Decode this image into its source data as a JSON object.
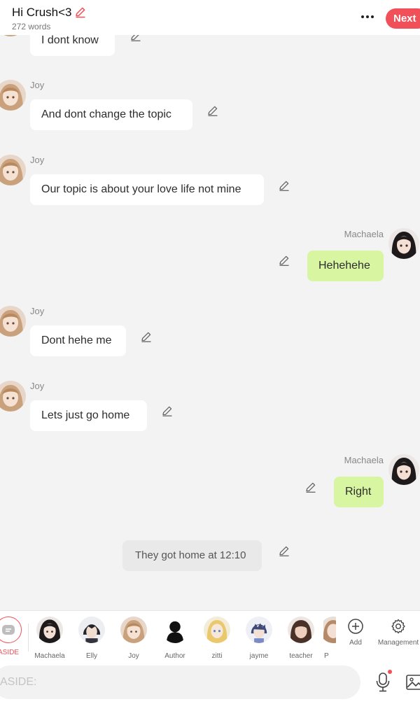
{
  "header": {
    "title": "Hi Crush<3",
    "word_count": "272 words",
    "next_label": "Next"
  },
  "messages": [
    {
      "type": "other",
      "sender": "Joy",
      "text": "I dont know"
    },
    {
      "type": "other",
      "sender": "Joy",
      "text": "And dont change the topic"
    },
    {
      "type": "other",
      "sender": "Joy",
      "text": "Our topic is about your love life not mine"
    },
    {
      "type": "me",
      "sender": "Machaela",
      "text": "Hehehehe"
    },
    {
      "type": "other",
      "sender": "Joy",
      "text": "Dont hehe me"
    },
    {
      "type": "other",
      "sender": "Joy",
      "text": "Lets just go home"
    },
    {
      "type": "me",
      "sender": "Machaela",
      "text": "Right"
    },
    {
      "type": "narration",
      "text": "They got home at 12:10"
    }
  ],
  "characters": [
    {
      "label": "ASIDE",
      "icon": "aside-icon"
    },
    {
      "label": "Machaela",
      "icon": "avatar-machaela"
    },
    {
      "label": "Elly",
      "icon": "avatar-elly"
    },
    {
      "label": "Joy",
      "icon": "avatar-joy"
    },
    {
      "label": "Author",
      "icon": "avatar-author"
    },
    {
      "label": "zitti",
      "icon": "avatar-zitti"
    },
    {
      "label": "jayme",
      "icon": "avatar-jayme"
    },
    {
      "label": "teacher",
      "icon": "avatar-teacher"
    },
    {
      "label": "P",
      "icon": "avatar-p"
    }
  ],
  "tools": {
    "add_label": "Add",
    "management_label": "Management"
  },
  "input": {
    "placeholder": "ASIDE:"
  },
  "colors": {
    "accent": "#f25058",
    "my_bubble": "#d8f5a2",
    "other_bubble": "#ffffff",
    "narration_bubble": "#e9e9e9",
    "background": "#f3f3f3"
  }
}
